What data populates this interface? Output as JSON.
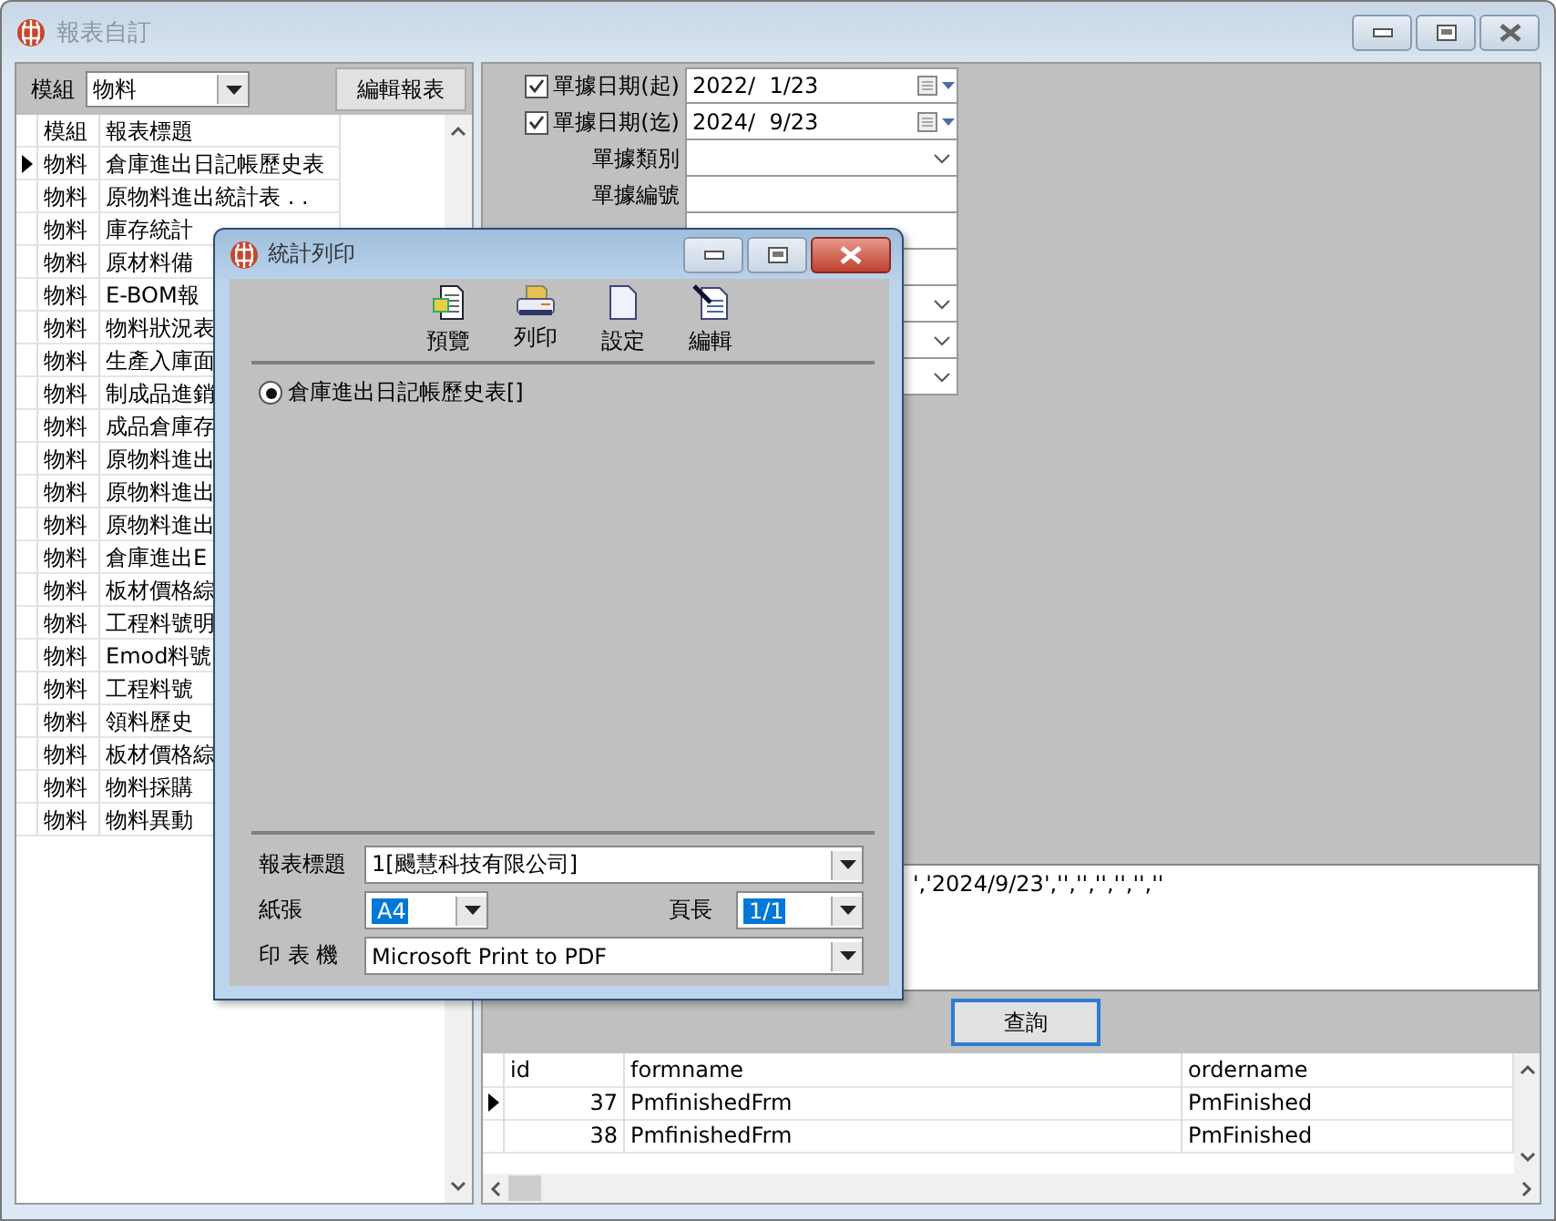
{
  "window": {
    "title": "報表自訂"
  },
  "left_panel": {
    "module_label": "模組",
    "module_value": "物料",
    "edit_button": "編輯報表",
    "table": {
      "columns": [
        "模組",
        "報表標題"
      ],
      "rows": [
        {
          "module": "物料",
          "title": "倉庫進出日記帳歷史表",
          "selected": true
        },
        {
          "module": "物料",
          "title": "原物料進出統計表 . .",
          "selected": false
        },
        {
          "module": "物料",
          "title": "庫存統計",
          "selected": false
        },
        {
          "module": "物料",
          "title": "原材料備",
          "selected": false
        },
        {
          "module": "物料",
          "title": "E-BOM報",
          "selected": false
        },
        {
          "module": "物料",
          "title": "物料狀況表",
          "selected": false
        },
        {
          "module": "物料",
          "title": "生產入庫面",
          "selected": false
        },
        {
          "module": "物料",
          "title": "制成品進銷",
          "selected": false
        },
        {
          "module": "物料",
          "title": "成品倉庫存",
          "selected": false
        },
        {
          "module": "物料",
          "title": "原物料進出",
          "selected": false
        },
        {
          "module": "物料",
          "title": "原物料進出",
          "selected": false
        },
        {
          "module": "物料",
          "title": "原物料進出",
          "selected": false
        },
        {
          "module": "物料",
          "title": "倉庫進出E",
          "selected": false
        },
        {
          "module": "物料",
          "title": "板材價格綜",
          "selected": false
        },
        {
          "module": "物料",
          "title": "工程料號明",
          "selected": false
        },
        {
          "module": "物料",
          "title": "Emod料號",
          "selected": false
        },
        {
          "module": "物料",
          "title": "工程料號",
          "selected": false
        },
        {
          "module": "物料",
          "title": "領料歷史",
          "selected": false
        },
        {
          "module": "物料",
          "title": "板材價格綜",
          "selected": false
        },
        {
          "module": "物料",
          "title": "物料採購",
          "selected": false
        },
        {
          "module": "物料",
          "title": "物料異動",
          "selected": false
        }
      ]
    }
  },
  "filters": [
    {
      "kind": "date",
      "label": "單據日期(起)",
      "checked": true,
      "value": "2022/  1/23"
    },
    {
      "kind": "date",
      "label": "單據日期(迄)",
      "checked": true,
      "value": "2024/  9/23"
    },
    {
      "kind": "combo",
      "label": "單據類別"
    },
    {
      "kind": "text",
      "label": "單據編號"
    },
    {
      "kind": "text"
    },
    {
      "kind": "text"
    },
    {
      "kind": "combo"
    },
    {
      "kind": "combo"
    },
    {
      "kind": "combo"
    }
  ],
  "query_text": "','2024/9/23','','','','','',''",
  "query_button": "查詢",
  "result_table": {
    "columns": [
      "id",
      "formname",
      "ordername"
    ],
    "rows": [
      {
        "id": "37",
        "formname": "PmfinishedFrm",
        "ordername": "PmFinished",
        "selected": true
      },
      {
        "id": "38",
        "formname": "PmfinishedFrm",
        "ordername": "PmFinished",
        "selected": false
      }
    ]
  },
  "dialog": {
    "title": "統計列印",
    "toolbar": [
      {
        "label": "預覽"
      },
      {
        "label": "列印"
      },
      {
        "label": "設定"
      },
      {
        "label": "編輯"
      }
    ],
    "options": [
      {
        "label": "倉庫進出日記帳歷史表[]",
        "selected": true
      }
    ],
    "report_title_label": "報表標題",
    "report_title_value": "1[颺慧科技有限公司]",
    "paper_label": "紙張",
    "paper_value": "A4",
    "page_length_label": "頁長",
    "page_length_value": "1/1",
    "printer_label": "印 表 機",
    "printer_value": "Microsoft Print to PDF"
  }
}
